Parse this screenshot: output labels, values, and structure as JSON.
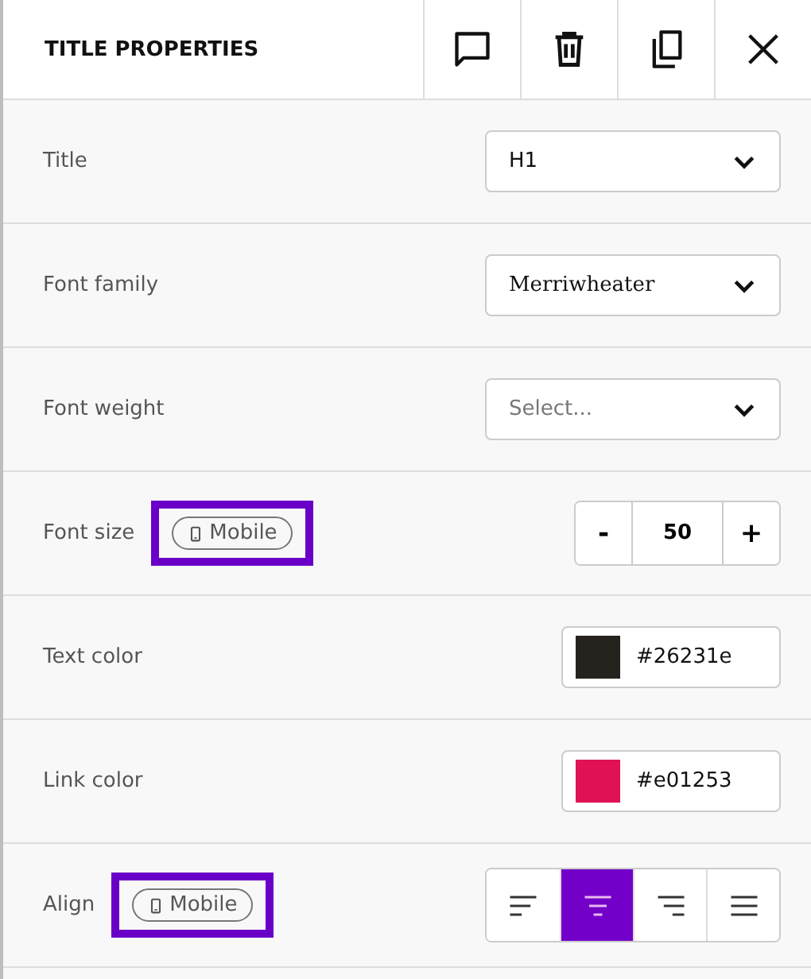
{
  "panel": {
    "title": "TITLE PROPERTIES",
    "actions": [
      {
        "kind": "comment"
      },
      {
        "kind": "delete"
      },
      {
        "kind": "duplicate"
      },
      {
        "kind": "close"
      }
    ]
  },
  "rows": [
    {
      "kind": "select",
      "label": "Title",
      "value": "H1"
    },
    {
      "kind": "select",
      "label": "Font family",
      "value": "Merriwheater",
      "serif": true
    },
    {
      "kind": "select",
      "label": "Font weight",
      "placeholder": "Select..."
    },
    {
      "kind": "stepper",
      "label": "Font size",
      "badge": {
        "label": "Mobile",
        "highlighted": true
      },
      "minus": "-",
      "value": "50",
      "plus": "+"
    },
    {
      "kind": "color",
      "label": "Text color",
      "value": "#26231e",
      "color": "#26231e"
    },
    {
      "kind": "color",
      "label": "Link color",
      "value": "#e01253",
      "color": "#e01253"
    },
    {
      "kind": "align",
      "label": "Align",
      "badge": {
        "label": "Mobile",
        "highlighted": true
      },
      "options": [
        {
          "kind": "left",
          "selected": false
        },
        {
          "kind": "center",
          "selected": true
        },
        {
          "kind": "right",
          "selected": false
        },
        {
          "kind": "justify",
          "selected": false
        }
      ]
    }
  ]
}
